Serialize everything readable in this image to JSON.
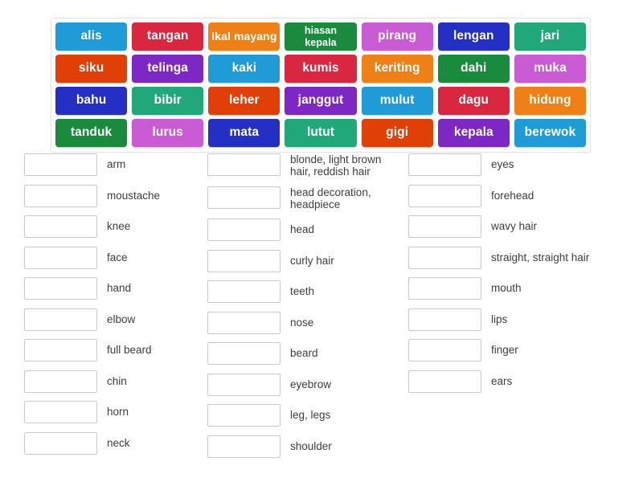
{
  "activity": {
    "type": "match-up",
    "colors": {
      "sky_blue": "#1f9bd8",
      "crimson": "#d8273f",
      "orange": "#ef8016",
      "dark_green": "#1a8a3c",
      "orchid": "#c95bd4",
      "deep_blue": "#2430c4",
      "emerald": "#21a87a",
      "orange_red": "#e04006",
      "purple": "#7d28c4",
      "slot_border": "#c9c9c9",
      "bank_border": "#e2e2e2",
      "text_on_tile": "#ffffff",
      "label_text": "#3d3d3d"
    }
  },
  "tile_bank": {
    "rows": [
      [
        {
          "label": "alis",
          "color": "#1f9bd8",
          "style": "normal"
        },
        {
          "label": "tangan",
          "color": "#d8273f",
          "style": "normal"
        },
        {
          "label": "ikal mayang",
          "color": "#ef8016",
          "style": "small"
        },
        {
          "label": "hiasan\nkepala",
          "color": "#1a8a3c",
          "style": "two-line"
        },
        {
          "label": "pirang",
          "color": "#c95bd4",
          "style": "normal"
        },
        {
          "label": "lengan",
          "color": "#2430c4",
          "style": "normal"
        },
        {
          "label": "jari",
          "color": "#21a87a",
          "style": "normal"
        }
      ],
      [
        {
          "label": "siku",
          "color": "#e04006",
          "style": "normal"
        },
        {
          "label": "telinga",
          "color": "#7d28c4",
          "style": "normal"
        },
        {
          "label": "kaki",
          "color": "#1f9bd8",
          "style": "normal"
        },
        {
          "label": "kumis",
          "color": "#d8273f",
          "style": "normal"
        },
        {
          "label": "keriting",
          "color": "#ef8016",
          "style": "normal"
        },
        {
          "label": "dahi",
          "color": "#1a8a3c",
          "style": "normal"
        },
        {
          "label": "muka",
          "color": "#c95bd4",
          "style": "normal"
        }
      ],
      [
        {
          "label": "bahu",
          "color": "#2430c4",
          "style": "normal"
        },
        {
          "label": "bibir",
          "color": "#21a87a",
          "style": "normal"
        },
        {
          "label": "leher",
          "color": "#e04006",
          "style": "normal"
        },
        {
          "label": "janggut",
          "color": "#7d28c4",
          "style": "normal"
        },
        {
          "label": "mulut",
          "color": "#1f9bd8",
          "style": "normal"
        },
        {
          "label": "dagu",
          "color": "#d8273f",
          "style": "normal"
        },
        {
          "label": "hidung",
          "color": "#ef8016",
          "style": "normal"
        }
      ],
      [
        {
          "label": "tanduk",
          "color": "#1a8a3c",
          "style": "normal"
        },
        {
          "label": "lurus",
          "color": "#c95bd4",
          "style": "normal"
        },
        {
          "label": "mata",
          "color": "#2430c4",
          "style": "normal"
        },
        {
          "label": "lutut",
          "color": "#21a87a",
          "style": "normal"
        },
        {
          "label": "gigi",
          "color": "#e04006",
          "style": "normal"
        },
        {
          "label": "kepala",
          "color": "#7d28c4",
          "style": "normal"
        },
        {
          "label": "berewok",
          "color": "#1f9bd8",
          "style": "normal"
        }
      ]
    ]
  },
  "answers": {
    "column_1": [
      {
        "slot_value": "",
        "label": "arm"
      },
      {
        "slot_value": "",
        "label": "moustache"
      },
      {
        "slot_value": "",
        "label": "knee"
      },
      {
        "slot_value": "",
        "label": "face"
      },
      {
        "slot_value": "",
        "label": "hand"
      },
      {
        "slot_value": "",
        "label": "elbow"
      },
      {
        "slot_value": "",
        "label": "full beard"
      },
      {
        "slot_value": "",
        "label": "chin"
      },
      {
        "slot_value": "",
        "label": "horn"
      },
      {
        "slot_value": "",
        "label": "neck"
      }
    ],
    "column_2": [
      {
        "slot_value": "",
        "label": "blonde, light brown\nhair, reddish hair",
        "lines": 2
      },
      {
        "slot_value": "",
        "label": "head decoration,\nheadpiece",
        "lines": 2
      },
      {
        "slot_value": "",
        "label": "head"
      },
      {
        "slot_value": "",
        "label": "curly hair"
      },
      {
        "slot_value": "",
        "label": "teeth"
      },
      {
        "slot_value": "",
        "label": "nose"
      },
      {
        "slot_value": "",
        "label": "beard"
      },
      {
        "slot_value": "",
        "label": "eyebrow"
      },
      {
        "slot_value": "",
        "label": "leg, legs"
      },
      {
        "slot_value": "",
        "label": "shoulder"
      }
    ],
    "column_3": [
      {
        "slot_value": "",
        "label": "eyes"
      },
      {
        "slot_value": "",
        "label": "forehead"
      },
      {
        "slot_value": "",
        "label": "wavy hair"
      },
      {
        "slot_value": "",
        "label": "straight, straight hair"
      },
      {
        "slot_value": "",
        "label": "mouth"
      },
      {
        "slot_value": "",
        "label": "lips"
      },
      {
        "slot_value": "",
        "label": "finger"
      },
      {
        "slot_value": "",
        "label": "ears"
      }
    ]
  }
}
